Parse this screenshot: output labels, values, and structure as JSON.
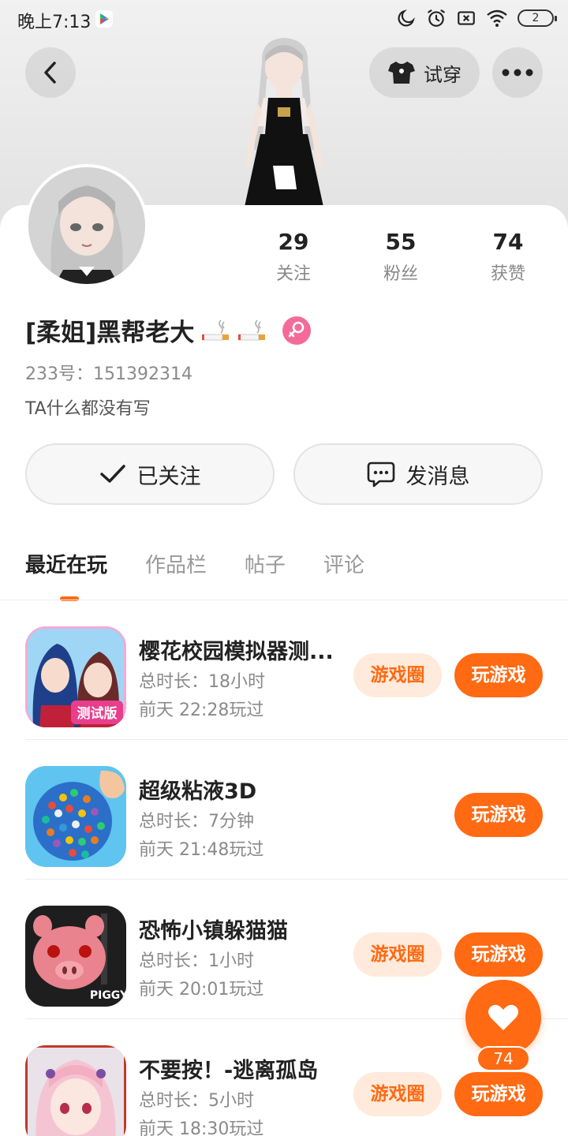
{
  "status_bar": {
    "time": "晚上7:13",
    "battery": "2",
    "icons": [
      "app-store-icon",
      "moon-icon",
      "alarm-icon",
      "sim-off-icon",
      "wifi-icon",
      "battery-icon"
    ]
  },
  "header": {
    "back_icon": "chevron-left-icon",
    "tryon_label": "试穿",
    "tryon_icon": "tshirt-icon",
    "more_icon": "more-dots-icon"
  },
  "profile": {
    "stats": [
      {
        "value": "29",
        "label": "关注"
      },
      {
        "value": "55",
        "label": "粉丝"
      },
      {
        "value": "74",
        "label": "获赞"
      }
    ],
    "nickname": "[柔姐]黑帮老大",
    "nickname_icons": [
      "cigarette-icon",
      "cigarette-icon"
    ],
    "gender_icon": "female-icon",
    "uid": "233号：151392314",
    "bio": "TA什么都没有写",
    "follow_label": "已关注",
    "message_label": "发消息"
  },
  "tabs": [
    {
      "label": "最近在玩",
      "active": true
    },
    {
      "label": "作品栏",
      "active": false
    },
    {
      "label": "帖子",
      "active": false
    },
    {
      "label": "评论",
      "active": false
    }
  ],
  "games": [
    {
      "title": "樱花校园模拟器测...",
      "duration": "总时长：18小时",
      "last_played": "前天 22:28玩过",
      "circle_label": "游戏圈",
      "play_label": "玩游戏",
      "icon_badge": "测试版"
    },
    {
      "title": "超级粘液3D",
      "duration": "总时长：7分钟",
      "last_played": "前天 21:48玩过",
      "circle_label": "",
      "play_label": "玩游戏",
      "icon_badge": ""
    },
    {
      "title": "恐怖小镇躲猫猫",
      "duration": "总时长：1小时",
      "last_played": "前天 20:01玩过",
      "circle_label": "游戏圈",
      "play_label": "玩游戏",
      "icon_badge": "PIGGY"
    },
    {
      "title": "不要按！-逃离孤岛",
      "duration": "总时长：5小时",
      "last_played": "前天 18:30玩过",
      "circle_label": "游戏圈",
      "play_label": "玩游戏",
      "icon_badge": ""
    }
  ],
  "like": {
    "count": "74",
    "icon": "heart-icon"
  },
  "colors": {
    "accent": "#ff6a13",
    "accent_light": "#ffeadb",
    "gender": "#f46b9a"
  }
}
